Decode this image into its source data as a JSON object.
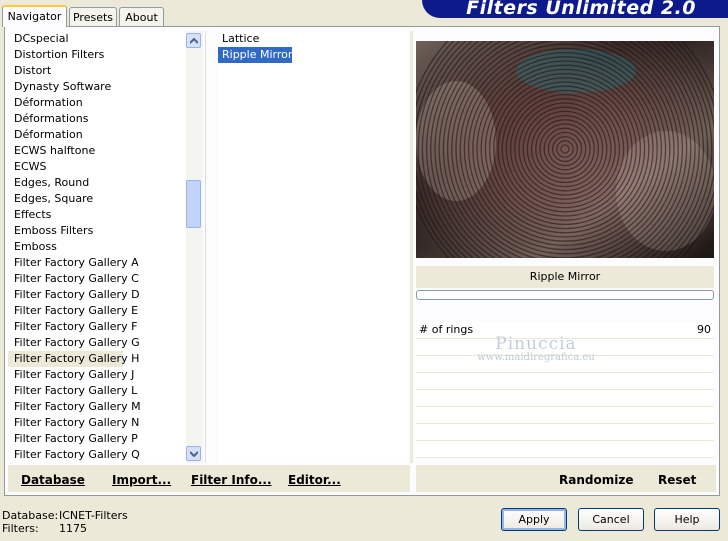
{
  "tabs": [
    "Navigator",
    "Presets",
    "About"
  ],
  "banner_title": "Filters Unlimited 2.0",
  "categories": [
    "DCspecial",
    "Distortion Filters",
    "Distort",
    "Dynasty Software",
    "Déformation",
    "Déformations",
    "Déformation",
    "ECWS halftone",
    "ECWS",
    "Edges, Round",
    "Edges, Square",
    "Effects",
    "Emboss Filters",
    "Emboss",
    "Filter Factory Gallery A",
    "Filter Factory Gallery C",
    "Filter Factory Gallery D",
    "Filter Factory Gallery E",
    "Filter Factory Gallery F",
    "Filter Factory Gallery G",
    "Filter Factory Gallery H",
    "Filter Factory Gallery J",
    "Filter Factory Gallery L",
    "Filter Factory Gallery M",
    "Filter Factory Gallery N",
    "Filter Factory Gallery P",
    "Filter Factory Gallery Q"
  ],
  "selected_category_index": 20,
  "filters": [
    "Lattice",
    "Ripple Mirror"
  ],
  "selected_filter_index": 1,
  "left_buttons": {
    "database": "Database",
    "import": "Import...",
    "filter_info": "Filter Info...",
    "editor": "Editor..."
  },
  "preview_filter_name": "Ripple Mirror",
  "params": [
    {
      "label": "# of rings",
      "value": "90"
    }
  ],
  "empty_param_rows": 7,
  "right_buttons": {
    "randomize": "Randomize",
    "reset": "Reset"
  },
  "watermark": {
    "name": "Pinuccia",
    "url": "www.maidiregrafica.eu"
  },
  "status": {
    "database_label": "Database:",
    "database_value": "ICNET-Filters",
    "filters_label": "Filters:",
    "filters_value": "1175"
  },
  "dialog_buttons": {
    "apply": "Apply",
    "cancel": "Cancel",
    "help": "Help"
  },
  "colors": {
    "banner": "#0c1a8c",
    "selection": "#316ac5",
    "window_bg": "#ece9d8"
  }
}
